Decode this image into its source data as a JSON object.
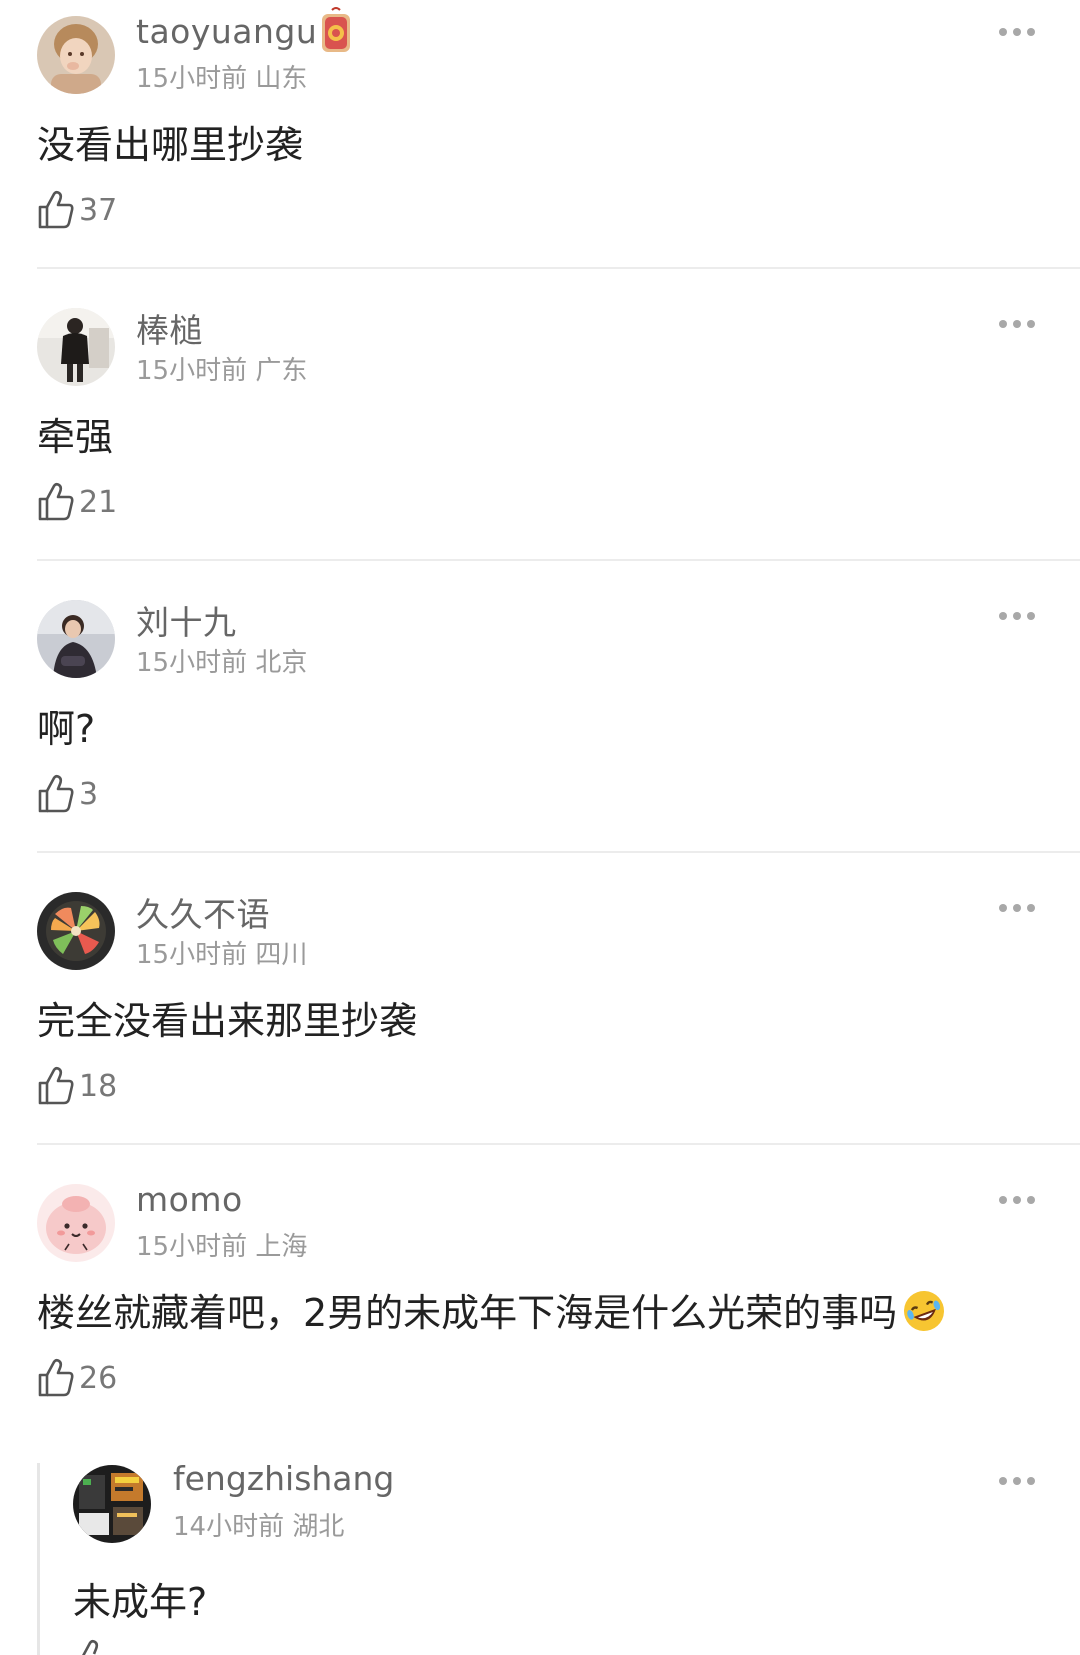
{
  "comments": [
    {
      "username": "taoyuangu",
      "time": "15小时前",
      "location": "山东",
      "text": "没看出哪里抄袭",
      "likes": "37",
      "avatar_icon": "child-portrait-avatar",
      "has_badge": true
    },
    {
      "username": "棒槌",
      "time": "15小时前",
      "location": "广东",
      "text": "牵强",
      "likes": "21",
      "avatar_icon": "standing-person-avatar"
    },
    {
      "username": "刘十九",
      "time": "15小时前",
      "location": "北京",
      "text": "啊?",
      "likes": "3",
      "avatar_icon": "woman-portrait-avatar"
    },
    {
      "username": "久久不语",
      "time": "15小时前",
      "location": "四川",
      "text": "完全没看出来那里抄袭",
      "likes": "18",
      "avatar_icon": "fruit-plate-avatar"
    },
    {
      "username": "momo",
      "time": "15小时前",
      "location": "上海",
      "text": "楼丝就藏着吧，2男的未成年下海是什么光荣的事吗",
      "likes": "26",
      "avatar_icon": "pink-cartoon-avatar",
      "trailing_emoji": "rolling-laughing-emoji"
    }
  ],
  "reply": {
    "username": "fengzhishang",
    "time": "14小时前",
    "location": "湖北",
    "text": "未成年?",
    "avatar_icon": "screenshot-collage-avatar"
  },
  "icons": {
    "more": "more-dots-icon",
    "like": "thumbs-up-icon",
    "badge": "red-lucky-bag-badge"
  },
  "colors": {
    "username": "#666666",
    "meta": "#9a9a9a",
    "text": "#222222",
    "divider": "#ececec"
  }
}
